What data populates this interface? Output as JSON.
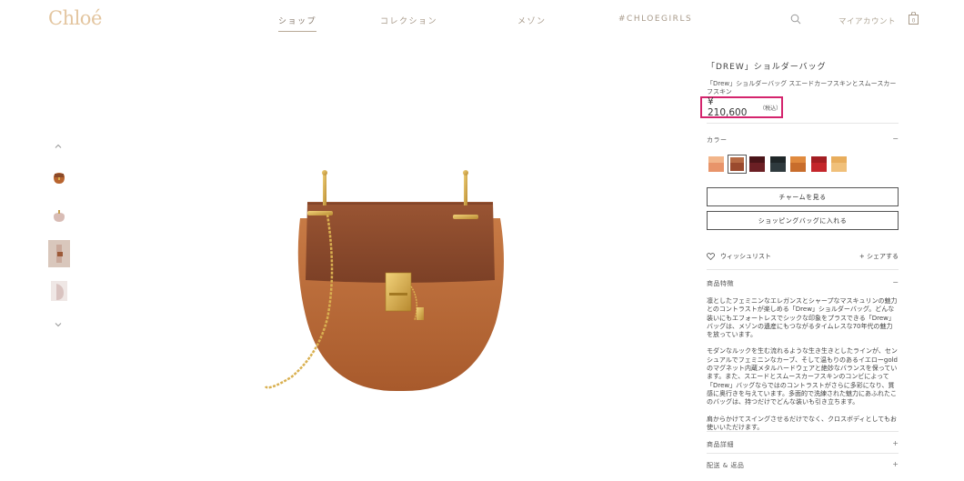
{
  "header": {
    "logo": "Chloé",
    "nav": [
      "ショップ",
      "コレクション",
      "メゾン",
      "#CHLOEGIRLS"
    ],
    "account": "マイアカウント",
    "bag_count": "0"
  },
  "product": {
    "title": "「DREW」ショルダーバッグ",
    "subtitle": "「Drew」ショルダーバッグ スエードカーフスキンとスムースカーフスキン",
    "price": "¥ 210,600",
    "tax": "（税込）",
    "color_label": "カラー",
    "color_toggle": "−",
    "swatches": [
      {
        "main": "#e8946a",
        "top": "#f2b58a",
        "selected": false
      },
      {
        "main": "#9a4a2e",
        "top": "#b66a44",
        "selected": true
      },
      {
        "main": "#6b1f24",
        "top": "#4a1418",
        "selected": false
      },
      {
        "main": "#2f3a3e",
        "top": "#1f2628",
        "selected": false
      },
      {
        "main": "#c86d2c",
        "top": "#e08a3e",
        "selected": false
      },
      {
        "main": "#c4262b",
        "top": "#a31e22",
        "selected": false
      },
      {
        "main": "#f0c07a",
        "top": "#e8ad5c",
        "selected": false
      }
    ],
    "charm_button": "チャームを見る",
    "add_to_bag_button": "ショッピングバッグに入れる",
    "wishlist": "ウィッシュリスト",
    "share": "+ シェアする",
    "features_label": "商品特徴",
    "features_toggle": "−",
    "description": [
      "凛としたフェミニンなエレガンスとシャープなマスキュリンの魅力とのコントラストが楽しめる「Drew」ショルダーバッグ。どんな装いにもエフォートレスでシックな印象をプラスできる「Drew」バッグは、メゾンの遺産にもつながるタイムレスな70年代の魅力を放っています。",
      "モダンなルックを生む流れるような生き生きとしたラインが、センシュアルでフェミニンなカーブ、そして温もりのあるイエローgoldのマグネット内蔵メタルハードウェアと絶妙なバランスを保っています。また、スエードとスムースカーフスキンのコンビによって「Drew」バッグならではのコントラストがさらに多彩になり、質感に奥行きを与えています。多面的で洗練された魅力にあふれたこのバッグは、持つだけでどんな装いも引き立ちます。",
      "肩からかけてスイングさせるだけでなく、クロスボディとしてもお使いいただけます。"
    ],
    "details_label": "商品詳細",
    "details_toggle": "+",
    "shipping_label": "配送 & 返品",
    "shipping_toggle": "+"
  }
}
